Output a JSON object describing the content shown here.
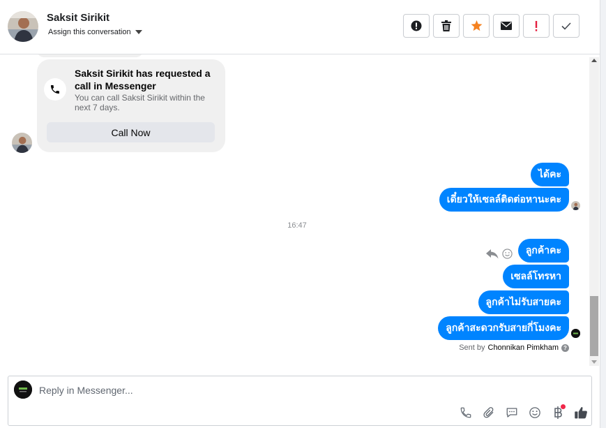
{
  "header": {
    "contact_name": "Saksit Sirikit",
    "assign_label": "Assign this conversation",
    "actions": [
      {
        "name": "spam-button",
        "icon": "alert-circle-icon"
      },
      {
        "name": "delete-button",
        "icon": "trash-icon"
      },
      {
        "name": "star-button",
        "icon": "star-icon",
        "color": "#f5811f"
      },
      {
        "name": "mark-unread-button",
        "icon": "envelope-icon"
      },
      {
        "name": "flag-button",
        "icon": "exclamation-icon",
        "color": "#e41e3f"
      },
      {
        "name": "mark-done-button",
        "icon": "check-icon"
      }
    ]
  },
  "call_card": {
    "title": "Saksit Sirikit has requested a call in Messenger",
    "subtitle": "You can call Saksit Sirikit within the next 7 days.",
    "button_label": "Call Now"
  },
  "messages_group_1": [
    {
      "text": "ได้คะ"
    },
    {
      "text": "เดี๋ยวให้เซลล์ติดต่อหานะคะ"
    }
  ],
  "timestamp": "16:47",
  "messages_group_2": [
    {
      "text": "ลูกค้าคะ"
    },
    {
      "text": "เซลล์โทรหา"
    },
    {
      "text": "ลูกค้าไม่รับสายคะ"
    },
    {
      "text": "ลูกค้าสะดวกรับสายกี่โมงคะ"
    }
  ],
  "sent_by": {
    "prefix": "Sent by",
    "name": "Chonnikan Pimkham"
  },
  "composer": {
    "placeholder": "Reply in Messenger...",
    "tools": [
      "phone-icon",
      "paperclip-icon",
      "chat-bubble-icon",
      "emoji-icon",
      "baht-icon",
      "like-icon"
    ]
  },
  "colors": {
    "bubble": "#0084ff",
    "card": "#f0f0f0",
    "accent_star": "#f5811f",
    "accent_red": "#e41e3f"
  }
}
